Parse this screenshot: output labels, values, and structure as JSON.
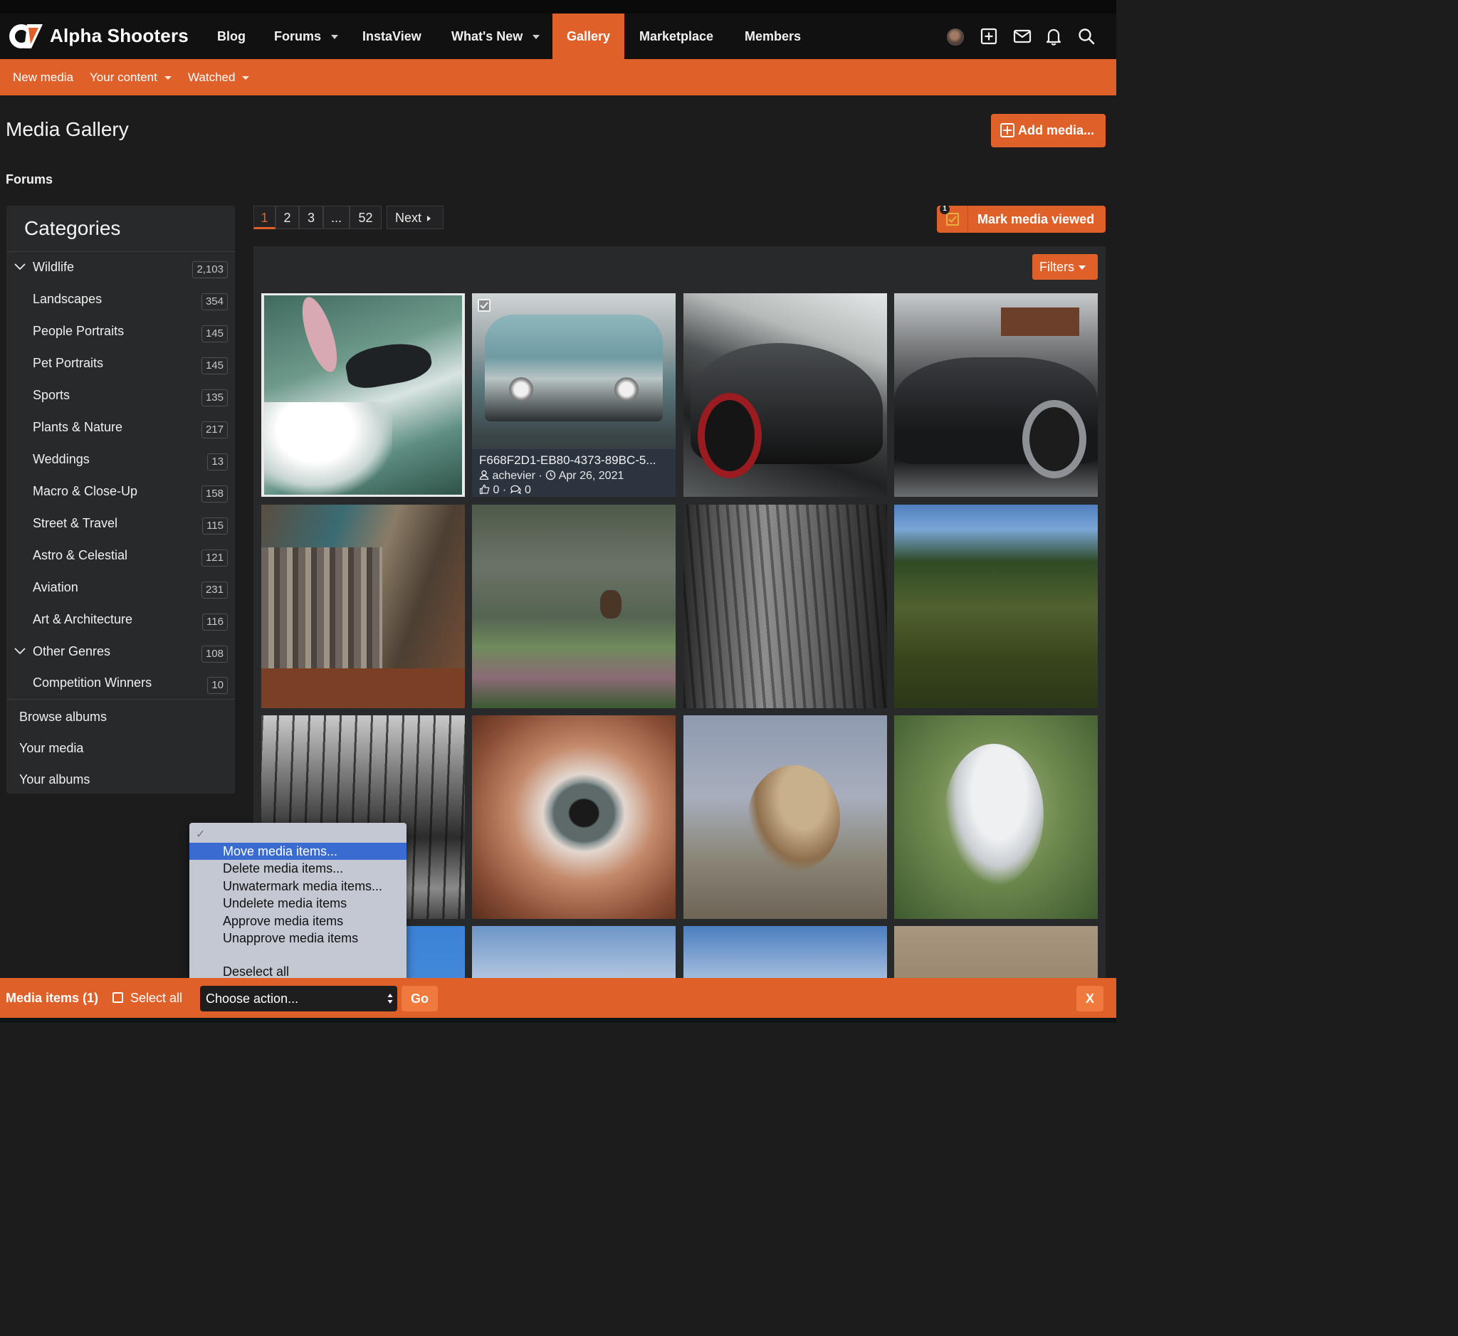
{
  "site": {
    "logo_text": "Alpha Shooters"
  },
  "nav": {
    "items": [
      {
        "label": "Blog",
        "has_caret": false,
        "active": false
      },
      {
        "label": "Forums",
        "has_caret": true,
        "active": false
      },
      {
        "label": "InstaView",
        "has_caret": false,
        "active": false
      },
      {
        "label": "What's New",
        "has_caret": true,
        "active": false
      },
      {
        "label": "Gallery",
        "has_caret": false,
        "active": true
      },
      {
        "label": "Marketplace",
        "has_caret": false,
        "active": false
      },
      {
        "label": "Members",
        "has_caret": false,
        "active": false
      }
    ],
    "icons": [
      "avatar",
      "plus-square-icon",
      "mail-icon",
      "bell-icon",
      "search-icon"
    ]
  },
  "subnav": {
    "items": [
      {
        "label": "New media",
        "has_caret": false
      },
      {
        "label": "Your content",
        "has_caret": true
      },
      {
        "label": "Watched",
        "has_caret": true
      }
    ]
  },
  "page": {
    "title": "Media Gallery",
    "add_media_label": "Add media...",
    "breadcrumb": "Forums"
  },
  "sidebar": {
    "heading": "Categories",
    "categories": [
      {
        "label": "Wildlife",
        "count": "2,103",
        "expandable": true
      },
      {
        "label": "Landscapes",
        "count": "354",
        "expandable": false
      },
      {
        "label": "People Portraits",
        "count": "145",
        "expandable": false
      },
      {
        "label": "Pet Portraits",
        "count": "145",
        "expandable": false
      },
      {
        "label": "Sports",
        "count": "135",
        "expandable": false
      },
      {
        "label": "Plants & Nature",
        "count": "217",
        "expandable": false
      },
      {
        "label": "Weddings",
        "count": "13",
        "expandable": false
      },
      {
        "label": "Macro & Close-Up",
        "count": "158",
        "expandable": false
      },
      {
        "label": "Street & Travel",
        "count": "115",
        "expandable": false
      },
      {
        "label": "Astro & Celestial",
        "count": "121",
        "expandable": false
      },
      {
        "label": "Aviation",
        "count": "231",
        "expandable": false
      },
      {
        "label": "Art & Architecture",
        "count": "116",
        "expandable": false
      },
      {
        "label": "Other Genres",
        "count": "108",
        "expandable": true
      },
      {
        "label": "Competition Winners",
        "count": "10",
        "expandable": false
      }
    ],
    "links": [
      "Browse albums",
      "Your media",
      "Your albums"
    ]
  },
  "pagination": {
    "pages": [
      "1",
      "2",
      "3",
      "...",
      "52"
    ],
    "current": "1",
    "next_label": "Next"
  },
  "mark_viewed": {
    "label": "Mark media viewed",
    "badge": "1"
  },
  "filters_label": "Filters",
  "media": {
    "selected_item": {
      "title": "F668F2D1-EB80-4373-89BC-5...",
      "author": "achevier",
      "date": "Apr 26, 2021",
      "likes": "0",
      "comments": "0"
    },
    "thumbnails": [
      "surfer",
      "blue-classic-car",
      "black-sports-car",
      "black-sedan",
      "wooden-fence-by-lake",
      "hawk-over-valley",
      "tree-bark",
      "meadow",
      "bw-forest-figure",
      "human-eye",
      "sparrow-on-reed",
      "bearded-reedling",
      "blue-sky",
      "clouds",
      "clouds-posts",
      "dry-field"
    ]
  },
  "action_dropdown": {
    "items": [
      "Move media items...",
      "Delete media items...",
      "Unwatermark media items...",
      "Undelete media items",
      "Approve media items",
      "Unapprove media items",
      "Deselect all"
    ],
    "highlighted": "Move media items..."
  },
  "bottom_bar": {
    "title": "Media items (1)",
    "select_all": "Select all",
    "select_value": "Choose action...",
    "go_label": "Go",
    "close_label": "X"
  },
  "colors": {
    "accent": "#e0602a",
    "nav_bg": "#111111",
    "page_bg": "#1c1c1d",
    "panel_bg": "#28292b",
    "dropdown_highlight": "#3a6bd1"
  }
}
